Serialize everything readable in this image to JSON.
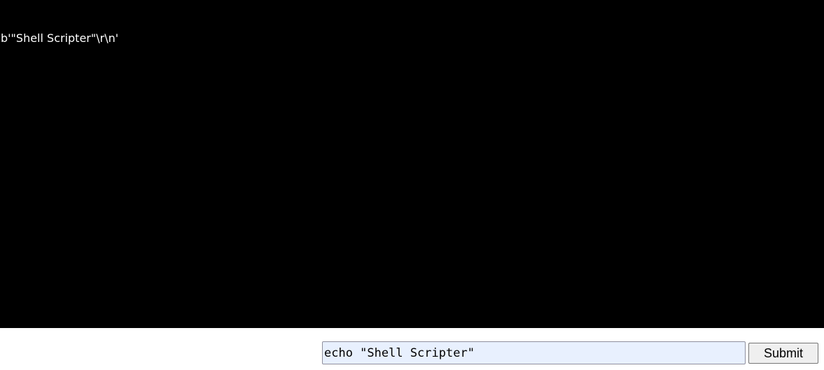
{
  "terminal": {
    "output_line": "b'\"Shell Scripter\"\\r\\n'"
  },
  "command": {
    "input_value": "echo \"Shell Scripter\"",
    "submit_label": "Submit"
  },
  "colors": {
    "terminal_background": "#000000",
    "terminal_text": "#ffffff",
    "input_autofill_background": "#e8f0fe"
  }
}
